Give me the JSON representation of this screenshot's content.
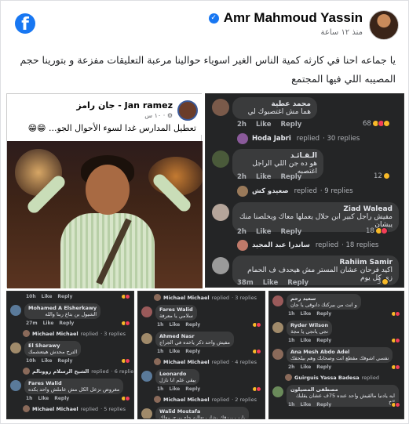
{
  "post": {
    "author": "Amr Mahmoud Yassin",
    "time": "منذ ١٢ ساعة",
    "caption": "يا جماعه احنا في كارثه كمية الناس الغير اسوياء حوالينا مرعبة التعليقات مفزعة و بتورينا حجم المصيبه اللي فيها المجتمع",
    "fb_logo": "f",
    "verified_icon": "✓"
  },
  "shot_left": {
    "name": "جان رامز - Jan ramez",
    "time": "١٠ س · ⚙",
    "text": "تعطيل المدارس غدا لسوء الأحوال الجو... 😁😁"
  },
  "shot_right": {
    "comments": [
      {
        "name": "محمد عطية",
        "text": "هما مش اغتصبوك لي",
        "actions": [
          "2h",
          "Like",
          "Reply"
        ],
        "reactions": "68",
        "reply_name": "Hoda Jabri",
        "reply_label": "replied",
        "reply_count": "· 30 replies"
      },
      {
        "name": "الـقـائـد",
        "text": "هو ده جن اللي الراجل اغتصبه",
        "actions": [
          "2h",
          "Like",
          "Reply"
        ],
        "reactions": "12",
        "reply_name": "صعيدو كش",
        "reply_label": "replied",
        "reply_count": "· 9 replies"
      },
      {
        "name": "Ziad Walead",
        "text": "مفيش راجل كبير ابن حلال يعملها معاك ويخلصنا منك يبشان",
        "actions": [
          "2h",
          "Like",
          "Reply"
        ],
        "reactions": "18",
        "reply_name": "ساندرا عبد المجيد",
        "reply_label": "replied",
        "reply_count": "· 18 replies"
      },
      {
        "name": "Rahiim Samir",
        "text": "اكيد فرحان عشان المستر مش هيحدف ف الحمام زي كل يوم",
        "actions": [
          "38m",
          "Like",
          "Reply"
        ],
        "reactions": "3"
      }
    ]
  },
  "bottom_shots": [
    {
      "items": [
        {
          "type": "act",
          "actions": [
            "10h",
            "Like",
            "Reply"
          ]
        },
        {
          "type": "comment",
          "name": "Mohamed A Elsherkawy",
          "text": "الشيول بن بتاع ربنا والله"
        },
        {
          "type": "act",
          "actions": [
            "27m",
            "Like",
            "Reply"
          ]
        },
        {
          "type": "reply",
          "name": "Michael Michael",
          "label": "replied",
          "count": "· 3 replies"
        },
        {
          "type": "comment",
          "name": "El Sharawy",
          "text": "الترح محدش هيتعشمك"
        },
        {
          "type": "act",
          "actions": [
            "10h",
            "Like",
            "Reply"
          ]
        },
        {
          "type": "reply",
          "name": "الشيخ الرسلام رووتالم",
          "label": "replied",
          "count": "· 6 replies"
        },
        {
          "type": "comment",
          "name": "Fares Walid",
          "text": "مغروض نزعل الكل مش عاملش واحد بكده"
        },
        {
          "type": "act",
          "actions": [
            "1h",
            "Like",
            "Reply"
          ]
        },
        {
          "type": "reply",
          "name": "Michael Michael",
          "label": "replied",
          "count": "· 5 replies"
        }
      ]
    },
    {
      "items": [
        {
          "type": "reply",
          "name": "Michael Michael",
          "label": "replied",
          "count": "· 3 replies"
        },
        {
          "type": "comment",
          "name": "Fares Walid",
          "text": "سلامي يا معرفة"
        },
        {
          "type": "act",
          "actions": [
            "1h",
            "Like",
            "Reply"
          ]
        },
        {
          "type": "comment",
          "name": "Ahmed Nasr",
          "text": "مفيش واحد ذكر ياخده في الجراج"
        },
        {
          "type": "act",
          "actions": [
            "1h",
            "Like",
            "Reply"
          ]
        },
        {
          "type": "reply",
          "name": "Michael Michael",
          "label": "replied",
          "count": "· 4 replies"
        },
        {
          "type": "comment",
          "name": "Leonardo",
          "text": "يبقي علم انا نازل"
        },
        {
          "type": "act",
          "actions": [
            "1h",
            "Like",
            "Reply"
          ]
        },
        {
          "type": "reply",
          "name": "Michael Michael",
          "label": "replied",
          "count": "· 2 replies"
        },
        {
          "type": "comment",
          "name": "Walid Mostafa",
          "text": "يارب يرزقك بشاب تعاليه جاء يوري معاك"
        }
      ]
    },
    {
      "items": [
        {
          "type": "comment",
          "name": "سعيد رحم",
          "text": "و انت من بيركتك دانوقى يا جان"
        },
        {
          "type": "act",
          "actions": [
            "1h",
            "Like",
            "Reply"
          ]
        },
        {
          "type": "comment",
          "name": "Ryder Wilson",
          "text": "نجى يانجى يا مجة"
        },
        {
          "type": "act",
          "actions": [
            "1h",
            "Like",
            "Reply"
          ]
        },
        {
          "type": "comment",
          "name": "Ana Mesh Abdo Adel",
          "text": "نفسي اشوفك مقطع انت وصحابك وهم بيلحقك"
        },
        {
          "type": "act",
          "actions": [
            "2h",
            "Like",
            "Reply"
          ]
        },
        {
          "type": "reply",
          "name": "Guirguis Yassa Badesa",
          "label": "replied",
          "count": ""
        },
        {
          "type": "comment",
          "name": "مصطفى المصيلون",
          "text": "ايه يادنيا مالقيش واحد عنده 75ف عشان يقلبك لاخ"
        },
        {
          "type": "act",
          "actions": [
            "1h",
            "Like",
            "Reply"
          ]
        }
      ]
    }
  ]
}
